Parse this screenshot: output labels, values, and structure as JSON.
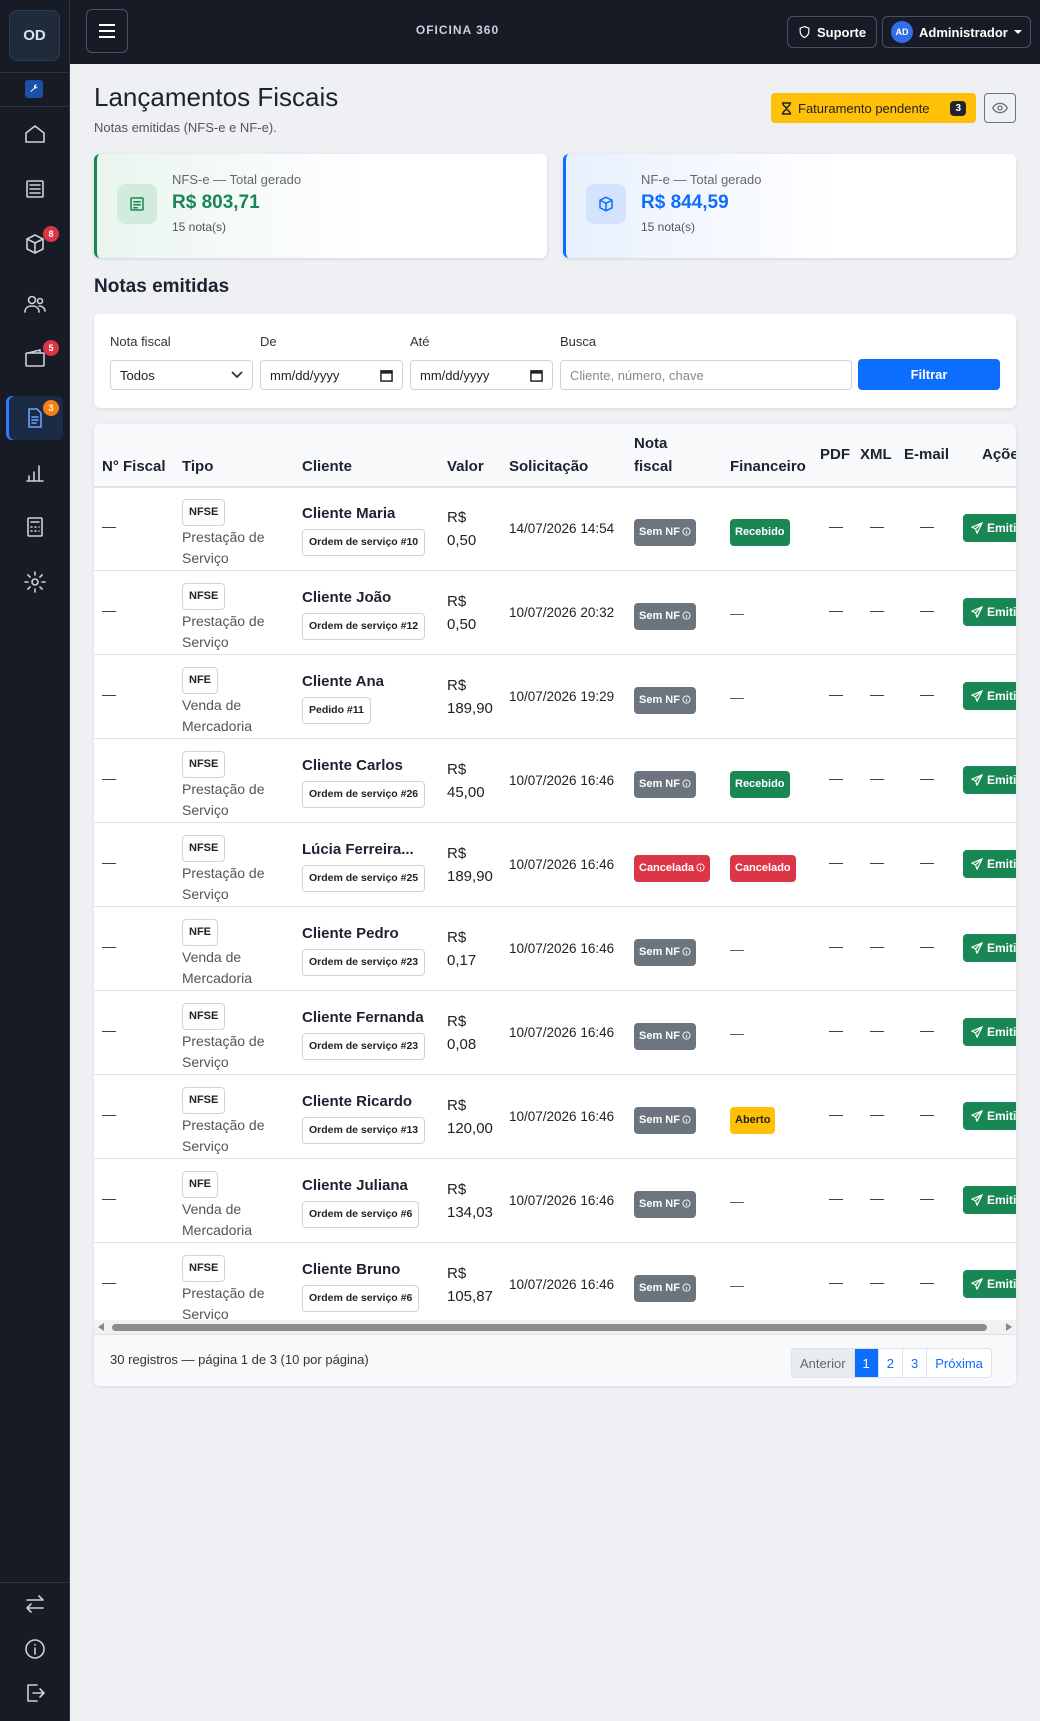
{
  "app": {
    "logo": "OD",
    "name": "OFICINA 360"
  },
  "topbar": {
    "support_label": "Suporte",
    "user_initials": "AD",
    "user_label": "Administrador"
  },
  "sidebar": {
    "badges": {
      "products": "8",
      "wallet": "5",
      "fiscal": "3"
    }
  },
  "page": {
    "title": "Lançamentos Fiscais",
    "subtitle": "Notas emitidas (NFS-e e NF-e).",
    "pending_label": "Faturamento pendente",
    "pending_count": "3"
  },
  "cards": {
    "nfse": {
      "label": "NFS-e — Total gerado",
      "value": "R$ 803,71",
      "count": "15 nota(s)"
    },
    "nfe": {
      "label": "NF-e — Total gerado",
      "value": "R$ 844,59",
      "count": "15 nota(s)"
    }
  },
  "section_title": "Notas emitidas",
  "filters": {
    "nota_label": "Nota fiscal",
    "nota_value": "Todos",
    "de_label": "De",
    "de_value": "mm/dd/yyyy",
    "ate_label": "Até",
    "ate_value": "mm/dd/yyyy",
    "busca_label": "Busca",
    "busca_placeholder": "Cliente, número, chave",
    "button": "Filtrar"
  },
  "table": {
    "headers": {
      "numero": "N° Fiscal",
      "tipo": "Tipo",
      "cliente": "Cliente",
      "valor": "Valor",
      "solicitacao": "Solicitação",
      "nota1": "Nota",
      "nota2": "fiscal",
      "financeiro": "Financeiro",
      "pdf": "PDF",
      "xml": "XML",
      "email": "E-mail",
      "acoes": "Açõe"
    },
    "dash": "—",
    "emit_label": "Emitir",
    "rows": [
      {
        "tipo": "NFSE",
        "tipo_desc": "Prestação de Serviço",
        "cliente": "Cliente Maria",
        "ref": "Ordem de serviço #10",
        "valor1": "R$",
        "valor2": "0,50",
        "data": "14/07/2026 14:54",
        "nota": "Sem NF",
        "nota_color": "gray",
        "fin": "Recebido",
        "fin_color": "green"
      },
      {
        "tipo": "NFSE",
        "tipo_desc": "Prestação de Serviço",
        "cliente": "Cliente João",
        "ref": "Ordem de serviço #12",
        "valor1": "R$",
        "valor2": "0,50",
        "data": "10/07/2026 20:32",
        "nota": "Sem NF",
        "nota_color": "gray",
        "fin": "—",
        "fin_color": ""
      },
      {
        "tipo": "NFE",
        "tipo_desc": "Venda de Mercadoria",
        "cliente": "Cliente Ana",
        "ref": "Pedido #11",
        "valor1": "R$",
        "valor2": "189,90",
        "data": "10/07/2026 19:29",
        "nota": "Sem NF",
        "nota_color": "gray",
        "fin": "—",
        "fin_color": ""
      },
      {
        "tipo": "NFSE",
        "tipo_desc": "Prestação de Serviço",
        "cliente": "Cliente Carlos",
        "ref": "Ordem de serviço #26",
        "valor1": "R$",
        "valor2": "45,00",
        "data": "10/07/2026 16:46",
        "nota": "Sem NF",
        "nota_color": "gray",
        "fin": "Recebido",
        "fin_color": "green"
      },
      {
        "tipo": "NFSE",
        "tipo_desc": "Prestação de Serviço",
        "cliente": "Lúcia Ferreira...",
        "ref": "Ordem de serviço #25",
        "valor1": "R$",
        "valor2": "189,90",
        "data": "10/07/2026 16:46",
        "nota": "Cancelada",
        "nota_color": "red",
        "fin": "Cancelado",
        "fin_color": "red"
      },
      {
        "tipo": "NFE",
        "tipo_desc": "Venda de Mercadoria",
        "cliente": "Cliente Pedro",
        "ref": "Ordem de serviço #23",
        "valor1": "R$",
        "valor2": "0,17",
        "data": "10/07/2026 16:46",
        "nota": "Sem NF",
        "nota_color": "gray",
        "fin": "—",
        "fin_color": ""
      },
      {
        "tipo": "NFSE",
        "tipo_desc": "Prestação de Serviço",
        "cliente": "Cliente Fernanda",
        "ref": "Ordem de serviço #23",
        "valor1": "R$",
        "valor2": "0,08",
        "data": "10/07/2026 16:46",
        "nota": "Sem NF",
        "nota_color": "gray",
        "fin": "—",
        "fin_color": ""
      },
      {
        "tipo": "NFSE",
        "tipo_desc": "Prestação de Serviço",
        "cliente": "Cliente Ricardo",
        "ref": "Ordem de serviço #13",
        "valor1": "R$",
        "valor2": "120,00",
        "data": "10/07/2026 16:46",
        "nota": "Sem NF",
        "nota_color": "gray",
        "fin": "Aberto",
        "fin_color": "yellow"
      },
      {
        "tipo": "NFE",
        "tipo_desc": "Venda de Mercadoria",
        "cliente": "Cliente Juliana",
        "ref": "Ordem de serviço #6",
        "valor1": "R$",
        "valor2": "134,03",
        "data": "10/07/2026 16:46",
        "nota": "Sem NF",
        "nota_color": "gray",
        "fin": "—",
        "fin_color": ""
      },
      {
        "tipo": "NFSE",
        "tipo_desc": "Prestação de Serviço",
        "cliente": "Cliente Bruno",
        "ref": "Ordem de serviço #6",
        "valor1": "R$",
        "valor2": "105,87",
        "data": "10/07/2026 16:46",
        "nota": "Sem NF",
        "nota_color": "gray",
        "fin": "—",
        "fin_color": ""
      }
    ]
  },
  "pagination": {
    "summary": "30 registros — página 1 de 3 (10 por página)",
    "prev": "Anterior",
    "pages": [
      "1",
      "2",
      "3"
    ],
    "next": "Próxima"
  }
}
